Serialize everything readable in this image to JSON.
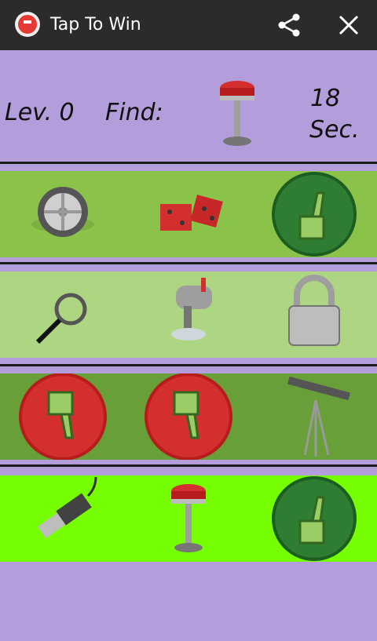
{
  "app": {
    "title": "Tap To Win",
    "icon": "red-tap-button-icon"
  },
  "toolbar": {
    "share_icon": "share-icon",
    "close_icon": "close-icon"
  },
  "status": {
    "level": "Lev. 0",
    "find_label": "Find:",
    "target_icon": "bar-stool-icon",
    "timer_value": "18",
    "timer_unit": "Sec."
  },
  "grid": [
    {
      "bg": "#8bc34a",
      "items": [
        "car-wheel-icon",
        "red-dice-icon",
        "thumbs-up-icon"
      ]
    },
    {
      "bg": "#aed581",
      "items": [
        "magnifying-glass-icon",
        "mailbox-icon",
        "padlock-icon"
      ]
    },
    {
      "bg": "#689f38",
      "items": [
        "thumbs-down-icon",
        "thumbs-down-icon",
        "telescope-icon"
      ]
    },
    {
      "bg": "#76ff03",
      "items": [
        "usb-plug-icon",
        "bar-stool-icon",
        "thumbs-up-icon"
      ]
    }
  ],
  "colors": {
    "page_bg": "#b39ddb",
    "appbar_bg": "#2b2b2b",
    "thumbs_up_green": "#2e7d32",
    "thumbs_down_red": "#c62828"
  }
}
